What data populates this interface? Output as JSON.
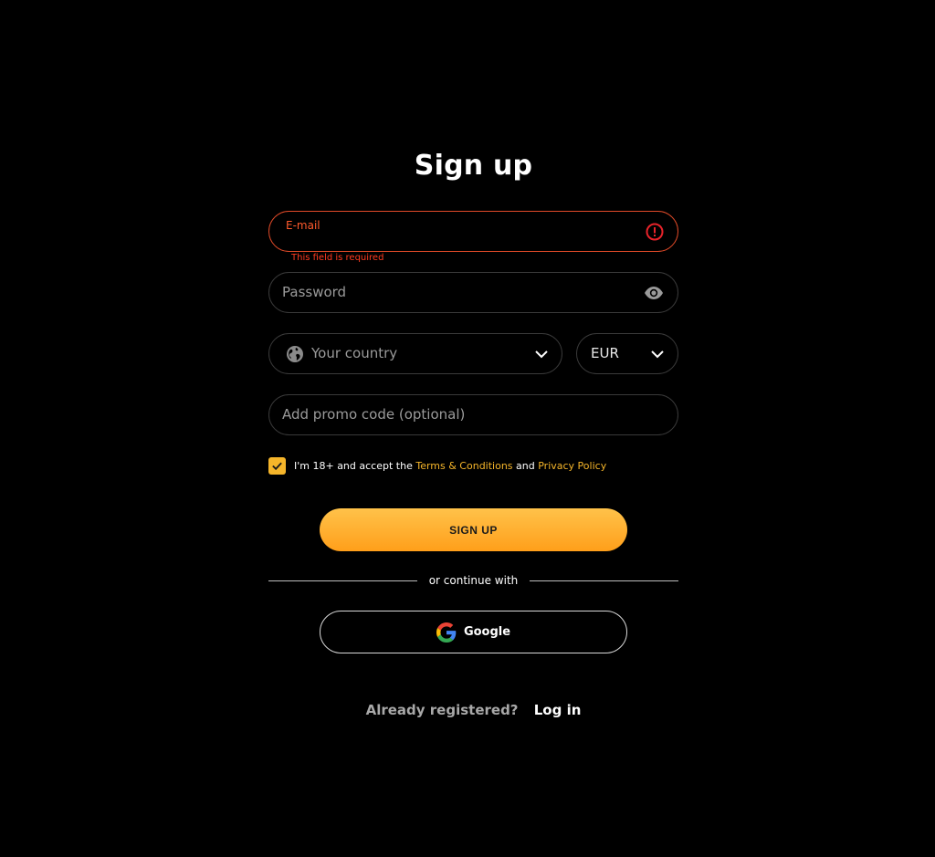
{
  "title": "Sign up",
  "email": {
    "label": "E-mail",
    "error": "This field is required"
  },
  "password": {
    "placeholder": "Password"
  },
  "country": {
    "placeholder": "Your country"
  },
  "currency": {
    "value": "EUR"
  },
  "promo": {
    "placeholder": "Add promo code (optional)"
  },
  "consent": {
    "checked": true,
    "prefix": "I'm 18+ and accept the",
    "terms_link": "Terms & Conditions",
    "conjunction": "and",
    "privacy_link": "Privacy Policy"
  },
  "signup_button": "SIGN UP",
  "divider_text": "or continue with",
  "google_button": "Google",
  "login": {
    "question": "Already registered?",
    "link": "Log in"
  },
  "colors": {
    "background": "#000000",
    "accent": "#f5b52a",
    "error": "#e04a28",
    "button_gradient_top": "#ffc24a",
    "button_gradient_bottom": "#ff9f1a"
  }
}
